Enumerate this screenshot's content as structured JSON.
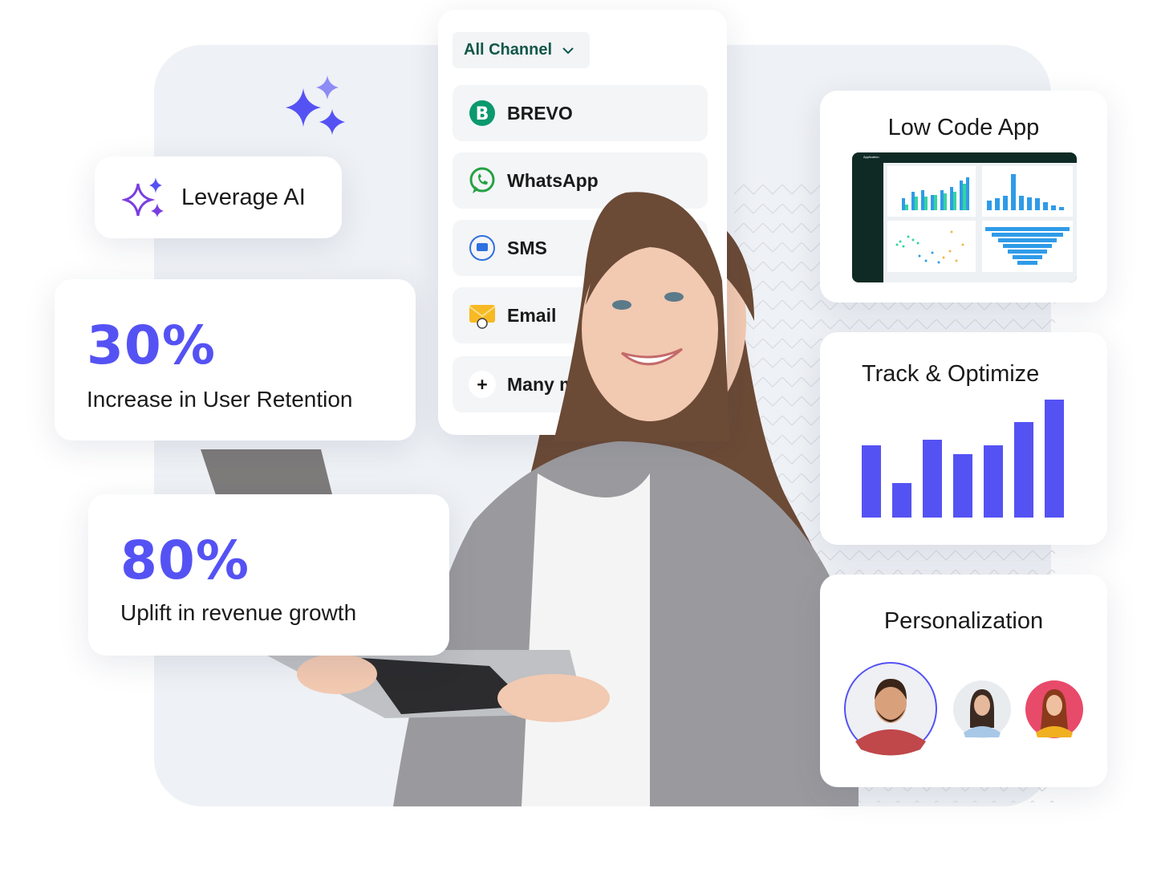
{
  "ai_card": {
    "label": "Leverage AI",
    "icon": "sparkles-icon"
  },
  "stats": [
    {
      "value": "30%",
      "label": "Increase in User Retention"
    },
    {
      "value": "80%",
      "label": "Uplift in revenue growth"
    }
  ],
  "channels": {
    "dropdown_label": "All Channel",
    "items": [
      {
        "label": "BREVO",
        "icon": "brevo-icon"
      },
      {
        "label": "WhatsApp",
        "icon": "whatsapp-icon"
      },
      {
        "label": "SMS",
        "icon": "sms-icon"
      },
      {
        "label": "Email",
        "icon": "email-icon"
      },
      {
        "label": "Many m",
        "icon": "plus-icon"
      }
    ]
  },
  "low_code": {
    "title": "Low Code App",
    "app_title": "Application"
  },
  "track": {
    "title": "Track & Optimize",
    "bar_levels_percent": [
      61,
      29,
      66,
      54,
      61,
      81,
      100
    ]
  },
  "personalization": {
    "title": "Personalization"
  },
  "colors": {
    "accent": "#5552f4",
    "channel_text": "#11574a",
    "brevo": "#0b996e",
    "whatsapp": "#25a244",
    "app_dark": "#0f2a24",
    "chart_blue": "#2f9be8",
    "chart_teal": "#36d3a4"
  }
}
